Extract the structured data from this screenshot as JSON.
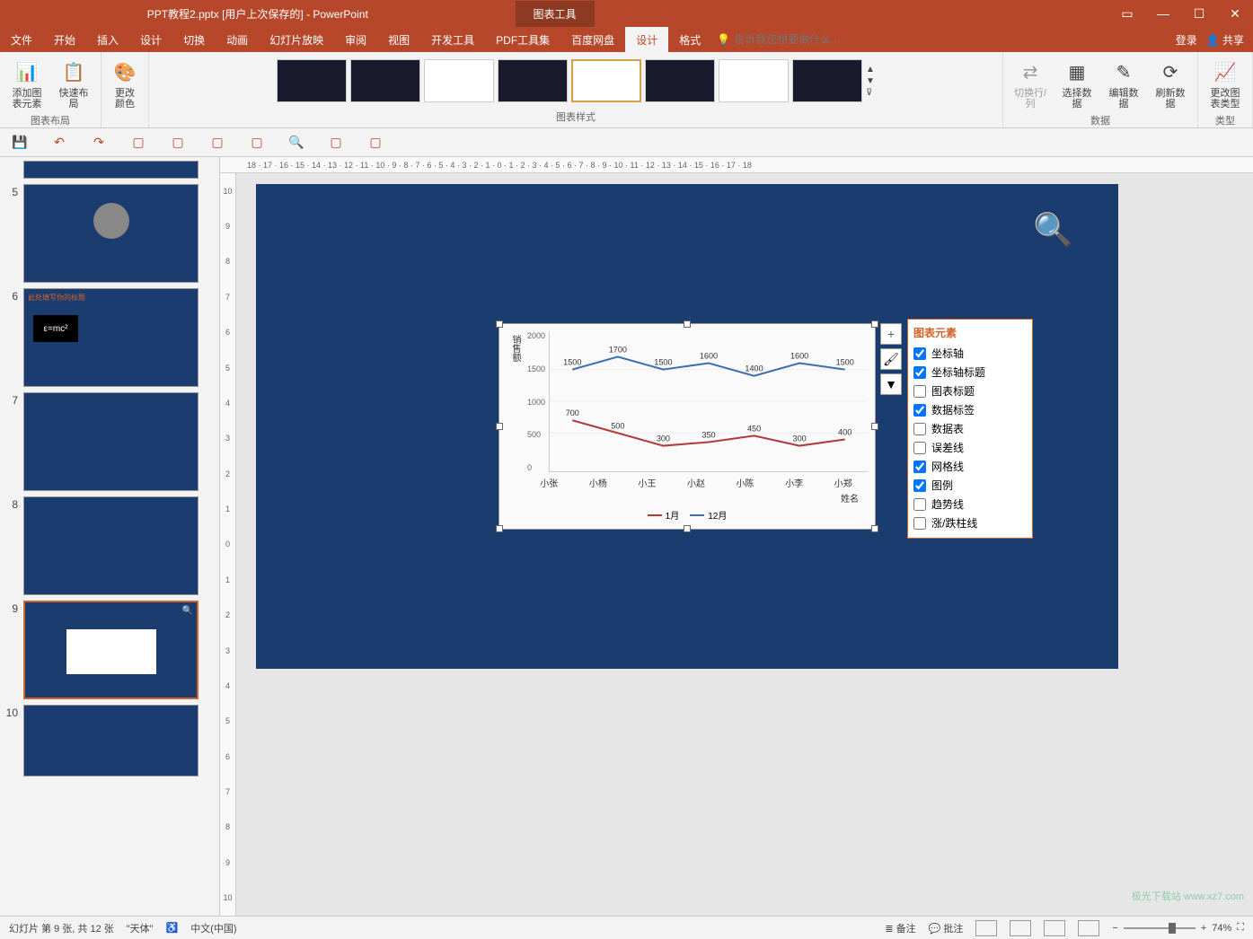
{
  "titlebar": {
    "title": "PPT教程2.pptx [用户上次保存的] - PowerPoint",
    "tool_tab": "图表工具"
  },
  "tabs": {
    "file": "文件",
    "home": "开始",
    "insert": "插入",
    "design": "设计",
    "transition": "切换",
    "animation": "动画",
    "slideshow": "幻灯片放映",
    "review": "审阅",
    "view": "视图",
    "developer": "开发工具",
    "pdf": "PDF工具集",
    "baidu": "百度网盘",
    "chart_design": "设计",
    "chart_format": "格式",
    "tell_me_placeholder": "告诉我您想要做什么...",
    "login": "登录",
    "share": "共享"
  },
  "ribbon": {
    "add_element": "添加图表元素",
    "quick_layout": "快速布局",
    "layout_group": "图表布局",
    "change_color": "更改颜色",
    "styles_group": "图表样式",
    "switch_rc": "切换行/列",
    "select_data": "选择数据",
    "edit_data": "编辑数据",
    "refresh_data": "刷新数据",
    "data_group": "数据",
    "change_type": "更改图表类型",
    "type_group": "类型"
  },
  "ruler": "18 · 17 · 16 · 15 · 14 · 13 · 12 · 11 · 10 · 9 · 8 · 7 · 6 · 5 · 4 · 3 · 2 · 1 · 0 · 1 · 2 · 3 · 4 · 5 · 6 · 7 · 8 · 9 · 10 · 11 · 12 · 13 · 14 · 15 · 16 · 17 · 18",
  "slides": {
    "numbers": [
      "5",
      "6",
      "7",
      "8",
      "9",
      "10"
    ]
  },
  "chart_elements": {
    "title": "图表元素",
    "axes": "坐标轴",
    "axis_titles": "坐标轴标题",
    "chart_title": "图表标题",
    "data_labels": "数据标签",
    "data_table": "数据表",
    "error_bars": "误差线",
    "gridlines": "网格线",
    "legend": "图例",
    "trendline": "趋势线",
    "updown_bars": "涨/跌柱线"
  },
  "chart": {
    "y_title": "销售额",
    "x_title": "姓名",
    "legend_jan": "1月",
    "legend_dec": "12月"
  },
  "chart_data": {
    "type": "line",
    "categories": [
      "小张",
      "小杨",
      "小王",
      "小赵",
      "小陈",
      "小李",
      "小郑"
    ],
    "series": [
      {
        "name": "1月",
        "values": [
          700,
          500,
          300,
          350,
          450,
          300,
          400
        ],
        "color": "#b23a3a"
      },
      {
        "name": "12月",
        "values": [
          1500,
          1700,
          1500,
          1600,
          1400,
          1600,
          1500
        ],
        "color": "#3a6fb2"
      }
    ],
    "ylabel": "销售额",
    "xlabel": "姓名",
    "ylim": [
      0,
      2000
    ],
    "y_ticks": [
      0,
      500,
      1000,
      1500,
      2000
    ]
  },
  "statusbar": {
    "slide_info": "幻灯片 第 9 张, 共 12 张",
    "theme": "\"天体\"",
    "lang": "中文(中国)",
    "notes": "备注",
    "comments": "批注",
    "zoom": "74%"
  },
  "watermark": "极光下载站\nwww.xz7.com"
}
